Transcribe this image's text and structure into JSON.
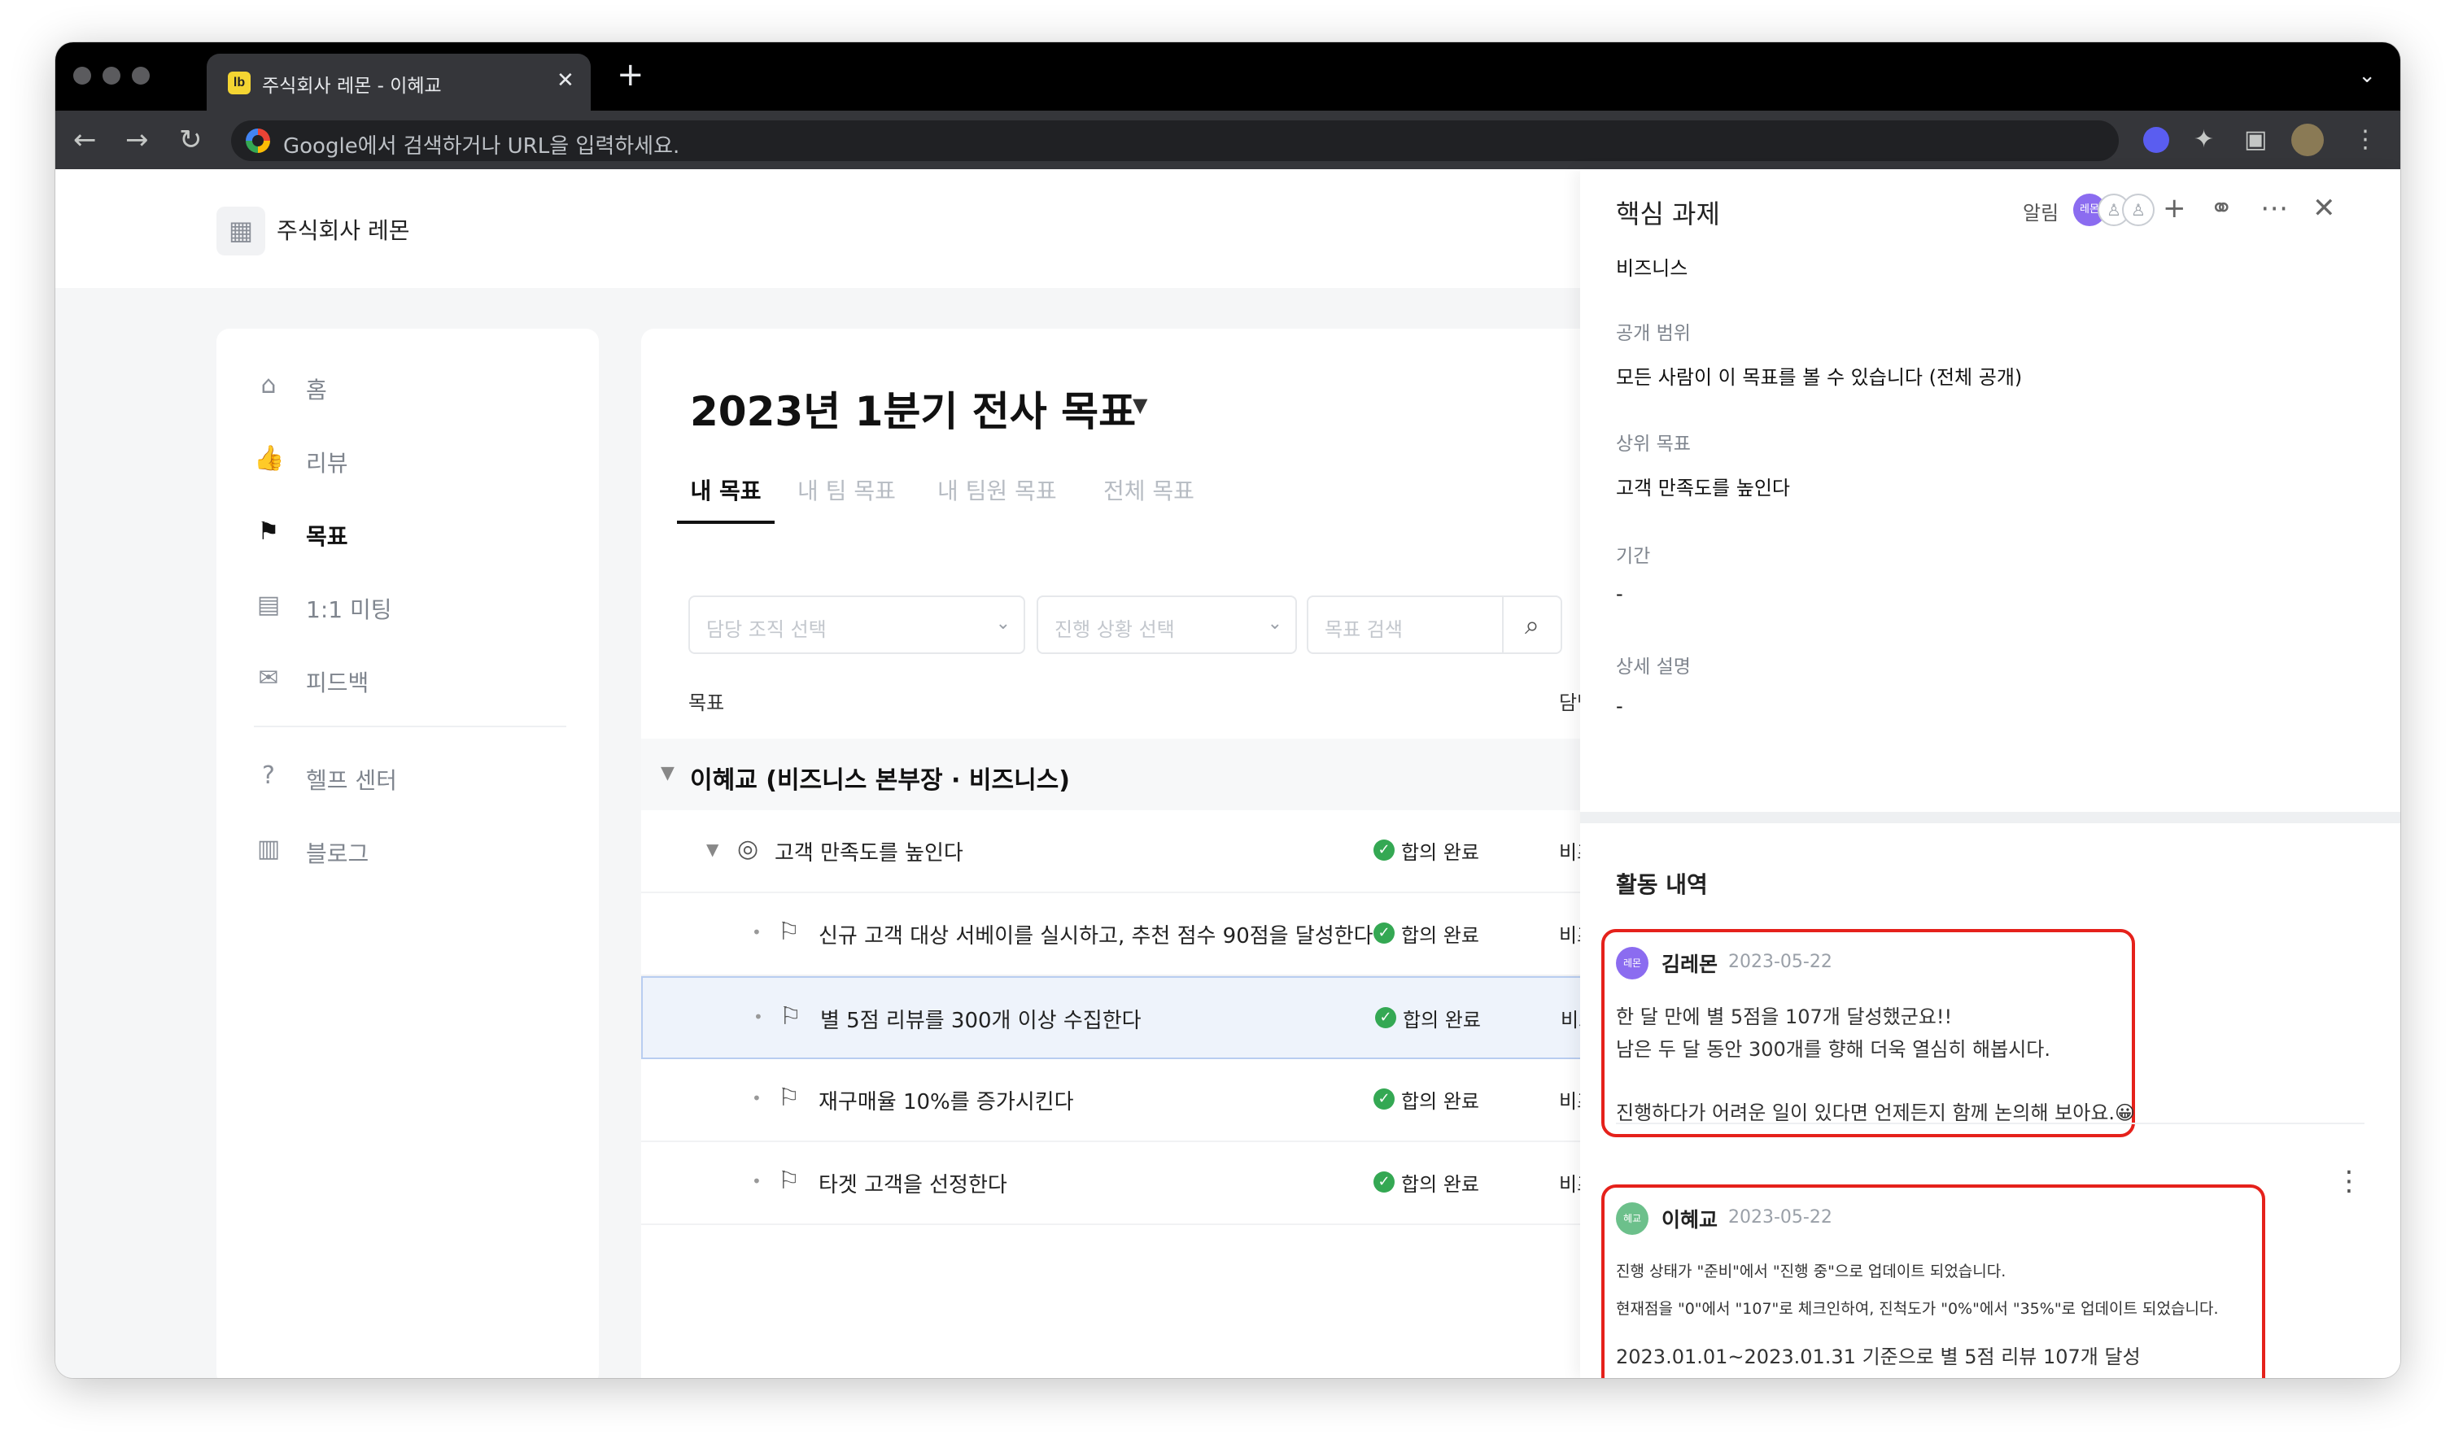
{
  "browser": {
    "tab_title": "주식회사 레몬 - 이혜교",
    "tab_favicon": "lb",
    "new_tab_label": "+",
    "tab_close_label": "✕",
    "omnibox_placeholder": "Google에서 검색하거나 URL을 입력하세요.",
    "colors": {
      "titlebar": "#000000",
      "toolbar": "#35363a"
    }
  },
  "app": {
    "company_name": "주식회사 레몬"
  },
  "sidebar": {
    "items": [
      {
        "label": "홈",
        "icon": "home-icon",
        "active": false
      },
      {
        "label": "리뷰",
        "icon": "thumbs-up-icon",
        "active": false
      },
      {
        "label": "목표",
        "icon": "flag-icon",
        "active": true
      },
      {
        "label": "1:1 미팅",
        "icon": "chat-icon",
        "active": false
      },
      {
        "label": "피드백",
        "icon": "mail-icon",
        "active": false
      },
      {
        "label": "헬프 센터",
        "icon": "help-icon",
        "active": false
      },
      {
        "label": "블로그",
        "icon": "blog-icon",
        "active": false
      }
    ]
  },
  "main": {
    "title": "2023년 1분기 전사 목표",
    "tabs": [
      {
        "label": "내 목표",
        "active": true
      },
      {
        "label": "내 팀 목표",
        "active": false
      },
      {
        "label": "내 팀원 목표",
        "active": false
      },
      {
        "label": "전체 목표",
        "active": false
      }
    ],
    "filters": {
      "org_placeholder": "담당 조직 선택",
      "status_placeholder": "진행 상황 선택",
      "search_placeholder": "목표 검색"
    },
    "columns": {
      "goal": "목표",
      "org": "담당 조직"
    },
    "group": {
      "title": "이혜교 (비즈니스 본부장 · 비즈니스)"
    },
    "goals": [
      {
        "title": "고객 만족도를 높인다",
        "status": "합의 완료",
        "org": "비즈니스"
      },
      {
        "title": "신규 고객 대상 서베이를 실시하고, 추천 점수 90점을 달성한다",
        "status": "합의 완료",
        "org": "비즈니스"
      },
      {
        "title": "별 5점 리뷰를 300개 이상 수집한다",
        "status": "합의 완료",
        "org": "비즈니스"
      },
      {
        "title": "재구매율 10%를 증가시킨다",
        "status": "합의 완료",
        "org": "비즈니스"
      },
      {
        "title": "타겟 고객을 선정한다",
        "status": "합의 완료",
        "org": "비즈니스"
      }
    ],
    "colors": {
      "status_green": "#34a853",
      "selected_row": "#eef3fb"
    }
  },
  "panel": {
    "title": "핵심 과제",
    "alert_label": "알림",
    "avatar_label": "레몬",
    "org_value": "비즈니스",
    "fields": {
      "visibility_label": "공개 범위",
      "visibility_value": "모든 사람이 이 목표를 볼 수 있습니다 (전체 공개)",
      "parent_label": "상위 목표",
      "parent_value": "고객 만족도를 높인다",
      "period_label": "기간",
      "period_value": "-",
      "description_label": "상세 설명",
      "description_value": "-"
    },
    "activity": {
      "title": "활동 내역",
      "comments": [
        {
          "avatar": "레몬",
          "author": "김레몬",
          "date": "2023-05-22",
          "lines": [
            "한 달 만에 별 5점을 107개 달성했군요!!",
            "남은 두 달 동안 300개를 향해 더욱 열심히 해봅시다.",
            "진행하다가 어려운 일이 있다면 언제든지 함께 논의해 보아요.😀"
          ]
        },
        {
          "avatar": "혜교",
          "author": "이혜교",
          "date": "2023-05-22",
          "lines": [
            "진행 상태가 \"준비\"에서 \"진행 중\"으로 업데이트 되었습니다.",
            "현재점을 \"0\"에서 \"107\"로 체크인하여, 진척도가 \"0%\"에서 \"35%\"로 업데이트 되었습니다.",
            "2023.01.01~2023.01.31 기준으로 별 5점 리뷰 107개 달성"
          ]
        }
      ]
    },
    "colors": {
      "highlight_border": "#e5211b",
      "avatar_purple": "#8b6cf0",
      "avatar_green": "#6cc08b"
    }
  }
}
